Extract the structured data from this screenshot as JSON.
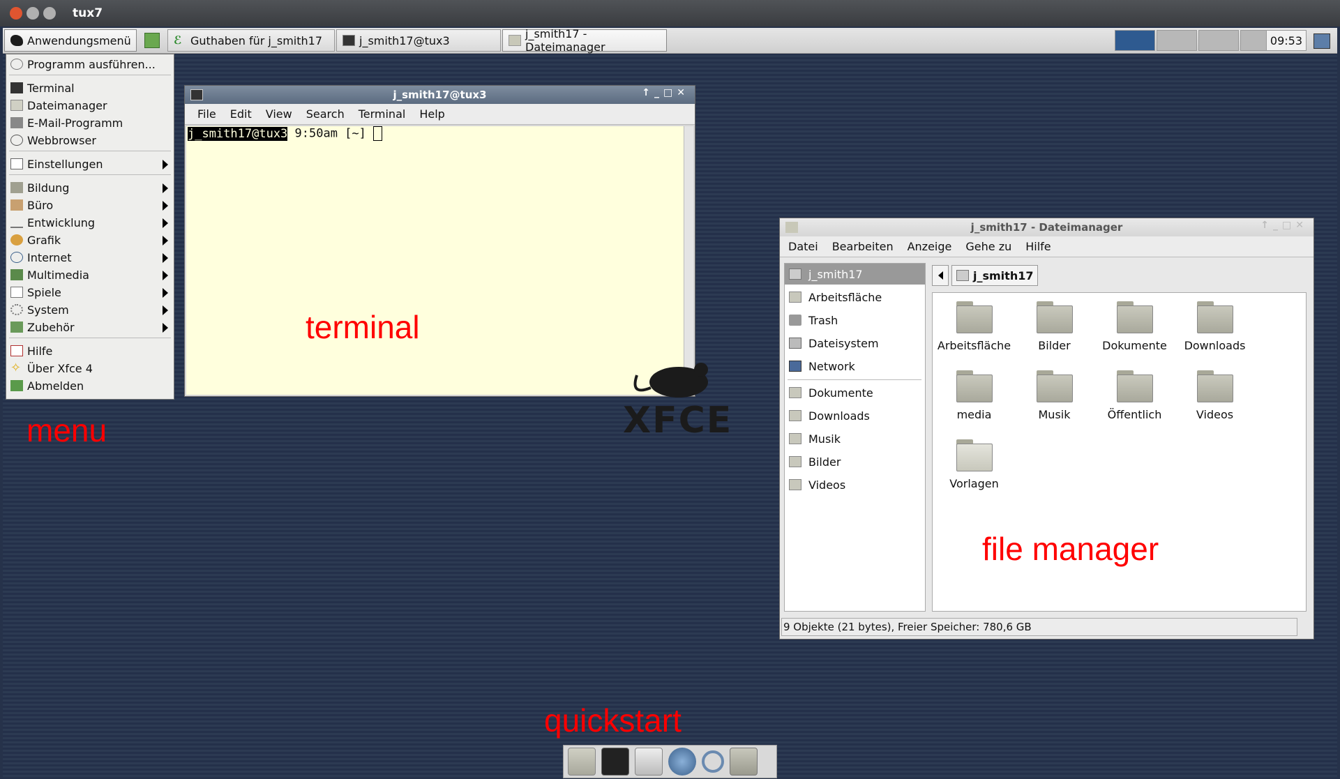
{
  "window": {
    "title": "tux7"
  },
  "panel": {
    "app_menu_label": "Anwendungsmenü",
    "tasks": [
      "Guthaben für j_smith17",
      "j_smith17@tux3",
      "j_smith17 - Dateimanager"
    ],
    "clock": "09:53"
  },
  "menu": {
    "run": "Programm ausführen...",
    "terminal": "Terminal",
    "filemanager": "Dateimanager",
    "email": "E-Mail-Programm",
    "browser": "Webbrowser",
    "settings": "Einstellungen",
    "education": "Bildung",
    "office": "Büro",
    "development": "Entwicklung",
    "graphics": "Grafik",
    "internet": "Internet",
    "multimedia": "Multimedia",
    "games": "Spiele",
    "system": "System",
    "accessories": "Zubehör",
    "help": "Hilfe",
    "about": "Über Xfce 4",
    "logout": "Abmelden"
  },
  "terminal": {
    "title": "j_smith17@tux3",
    "menus": [
      "File",
      "Edit",
      "View",
      "Search",
      "Terminal",
      "Help"
    ],
    "prompt_host": "j_smith17@tux3",
    "prompt_rest": " 9:50am [~] "
  },
  "filemanager": {
    "title": "j_smith17 - Dateimanager",
    "menus": [
      "Datei",
      "Bearbeiten",
      "Anzeige",
      "Gehe zu",
      "Hilfe"
    ],
    "sidebar_top": [
      "j_smith17",
      "Arbeitsfläche",
      "Trash",
      "Dateisystem",
      "Network"
    ],
    "sidebar_bookmarks": [
      "Dokumente",
      "Downloads",
      "Musik",
      "Bilder",
      "Videos"
    ],
    "location": "j_smith17",
    "items": [
      "Arbeitsfläche",
      "Bilder",
      "Dokumente",
      "Downloads",
      "media",
      "Musik",
      "Öffentlich",
      "Videos",
      "Vorlagen"
    ],
    "status": "9 Objekte (21 bytes), Freier Speicher: 780,6 GB"
  },
  "desktop": {
    "logo_text": "XFCE"
  },
  "annotations": {
    "menu": "menu",
    "terminal": "terminal",
    "filemanager": "file manager",
    "quickstart": "quickstart"
  },
  "colors": {
    "annotation": "#ff0000",
    "desktop": "#26324a",
    "terminal_bg": "#ffffdd"
  }
}
